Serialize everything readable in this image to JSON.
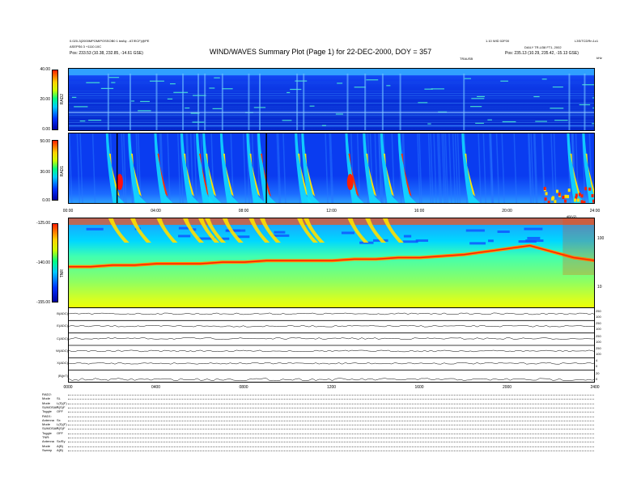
{
  "header": {
    "left_line1": "0.020-3(2000MPOMIPOSSOB0 1 twAly - AT/ECF)@PE",
    "left_line2": "ASEPS6 3 +1110.10C",
    "left_line3": "Pos: 233.53 (10.38, 232.85, -14.61 GSE)",
    "center": "WIND/WAVES Summary Plot (Page 1) for 22-DEC-2000, DOY = 357",
    "center_sub": "TRAUSB",
    "right_line1": "1.10 WID 02F00",
    "right_mid": "L3S/TCDRn.1c1",
    "right_line2": "DAILY TR-U38 FT1, 2002",
    "right_line3": "Pos: 235.13 (10.29, 235.42, -15.13 GSE)",
    "right_corner": "kHz"
  },
  "panels": {
    "rad2": {
      "label": "RAD2",
      "ticks": [
        "40.00",
        "20.00",
        "0.00"
      ]
    },
    "rad1": {
      "label": "RAD1",
      "ticks": [
        "50.00",
        "30.00",
        "0.00"
      ]
    },
    "tnr": {
      "label": "TNR",
      "ticks": [
        "-125.00",
        "-140.00",
        "-155.00"
      ],
      "right_ticks": [
        "100",
        "10"
      ],
      "right_label": "dB(V2)"
    },
    "time_ticks": [
      "00:00",
      "04:00",
      "08:00",
      "12:00",
      "16:00",
      "20:00",
      "24:00"
    ]
  },
  "strips": [
    {
      "label": "B(ADC)",
      "r1": "250",
      "r2": "100"
    },
    {
      "label": "E(ADC)",
      "r1": "250",
      "r2": "100"
    },
    {
      "label": "C(ADC)",
      "r1": "250",
      "r2": "100"
    },
    {
      "label": "W(ADC)",
      "r1": "250",
      "r2": "100"
    },
    {
      "label": "X(ADC)",
      "r1": "4",
      "r2": "0"
    },
    {
      "label": "|B|(nT)",
      "r1": "20",
      "r2": "0"
    }
  ],
  "bottom_ticks": [
    "0000",
    "0400",
    "0800",
    "1200",
    "1600",
    "2000",
    "2400"
  ],
  "info": {
    "rad2": {
      "head": "RAD2:",
      "rows": [
        [
          "Mode",
          "SL"
        ],
        [
          "Mode",
          "L(S)(F)"
        ],
        [
          "SUMOSAP",
          "S(S)F"
        ],
        [
          "Toggle",
          "OFF"
        ]
      ]
    },
    "rad1": {
      "head": "RAD1:",
      "rows": [
        [
          "Antenna",
          "Sx"
        ],
        [
          "Mode",
          "L(S)(F)"
        ],
        [
          "SUMOSAP",
          "S(S)F"
        ],
        [
          "Toggle",
          "OFF"
        ]
      ]
    },
    "tnr": {
      "head": "TNR:",
      "rows": [
        [
          "Antenna",
          "Sx/Ey"
        ],
        [
          "Mode",
          "A(B)"
        ],
        [
          "Sweep",
          "A(B)"
        ]
      ]
    }
  },
  "chart_data": {
    "type": "heatmap",
    "title": "WIND/WAVES Summary Plot (Page 1) for 22-DEC-2000, DOY = 357",
    "x_unit": "UT hours",
    "x_range": [
      0,
      24
    ],
    "panels": [
      {
        "name": "RAD2",
        "ylim": [
          0,
          40
        ],
        "colorbar": [
          0,
          40
        ]
      },
      {
        "name": "RAD1",
        "ylim": [
          0,
          50
        ],
        "colorbar": [
          0,
          50
        ]
      },
      {
        "name": "TNR",
        "colorbar": [
          -155,
          -125
        ],
        "right_axis": [
          "100",
          "10"
        ]
      }
    ],
    "type_iii_burst_hours": [
      1.8,
      2.8,
      4.0,
      5.2,
      5.9,
      6.2,
      7.0,
      8.2,
      8.7,
      10.4,
      10.7,
      12.7,
      13.5,
      14.3,
      15.1,
      18.0,
      22.8,
      23.5
    ],
    "tnr_plasma_line_db": [
      -141,
      -141,
      -140.5,
      -140.5,
      -140,
      -140,
      -140,
      -139.5,
      -139.5,
      -139,
      -139,
      -139,
      -139,
      -138.5,
      -138.5,
      -138,
      -138,
      -137.5,
      -137,
      -136,
      -135,
      -134,
      -136,
      -138,
      -139
    ]
  }
}
